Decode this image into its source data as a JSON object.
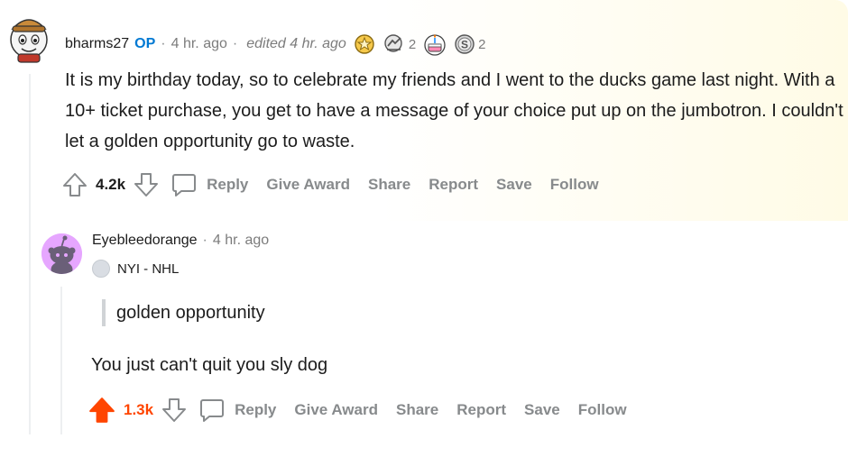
{
  "comments": [
    {
      "username": "bharms27",
      "op_badge": "OP",
      "time": "4 hr. ago",
      "edited": "edited 4 hr. ago",
      "awards": [
        {
          "icon": "gold-award-icon",
          "count": ""
        },
        {
          "icon": "helpful-award-icon",
          "count": "2"
        },
        {
          "icon": "birthday-cake-award-icon",
          "count": ""
        },
        {
          "icon": "silver-award-icon",
          "count": "2"
        }
      ],
      "body": "It is my birthday today, so to celebrate my friends and I went to the ducks game last night. With a 10+ ticket purchase, you get to have a message of your choice put up on the jumbotron. I couldn't let a golden opportunity go to waste.",
      "score": "4.2k",
      "actions": {
        "reply": "Reply",
        "give_award": "Give Award",
        "share": "Share",
        "report": "Report",
        "save": "Save",
        "follow": "Follow"
      }
    },
    {
      "username": "Eyebleedorange",
      "time": "4 hr. ago",
      "flair": "NYI - NHL",
      "quote": "golden opportunity",
      "body": "You just can't quit you sly dog",
      "score": "1.3k",
      "upvoted": true,
      "actions": {
        "reply": "Reply",
        "give_award": "Give Award",
        "share": "Share",
        "report": "Report",
        "save": "Save",
        "follow": "Follow"
      }
    }
  ],
  "colors": {
    "upvote": "#ff4500",
    "op": "#0079d3",
    "meta": "#7c7c7c"
  }
}
